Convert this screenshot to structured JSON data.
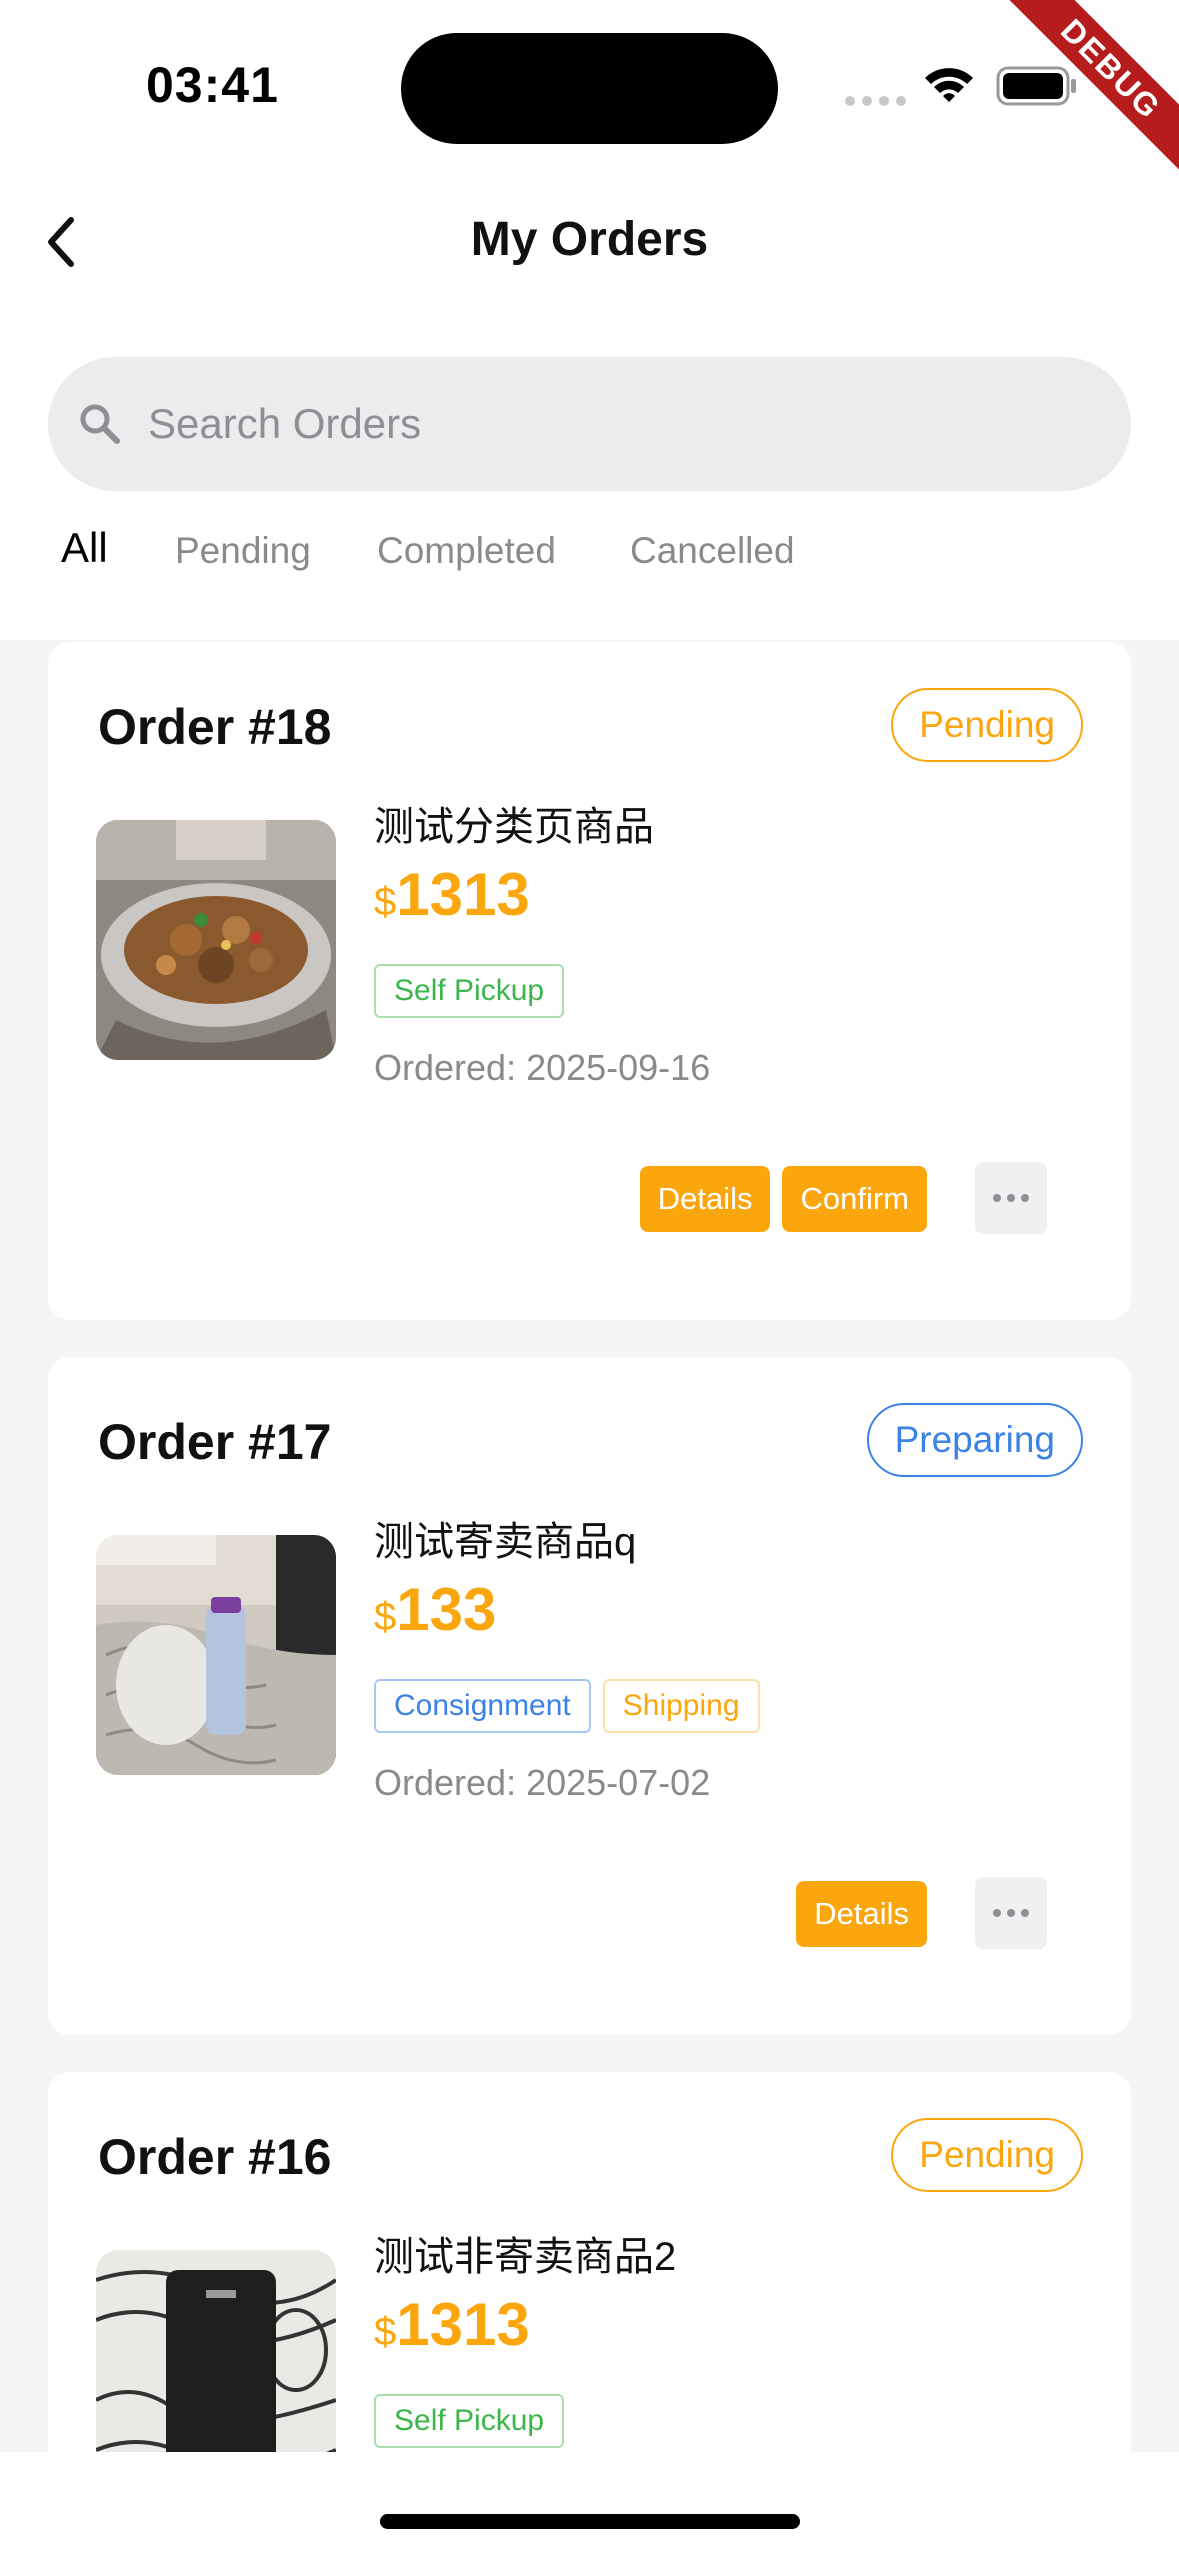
{
  "status": {
    "time": "03:41",
    "debug_label": "DEBUG"
  },
  "header": {
    "title": "My Orders"
  },
  "search": {
    "placeholder": "Search Orders"
  },
  "tabs": [
    {
      "label": "All",
      "active": true
    },
    {
      "label": "Pending",
      "active": false
    },
    {
      "label": "Completed",
      "active": false
    },
    {
      "label": "Cancelled",
      "active": false
    }
  ],
  "colors": {
    "accent": "#fba60c",
    "pending": "#fba60c",
    "preparing": "#3b82e6",
    "pickup_green": "#3cb54a",
    "background": "#f5f5f7"
  },
  "orders": [
    {
      "order_no": "Order #18",
      "status": "Pending",
      "product": "测试分类页商品",
      "currency": "$",
      "price": "1313",
      "tags": [
        "Self Pickup"
      ],
      "date": "Ordered: 2025-09-16",
      "actions": [
        "Details",
        "Confirm"
      ]
    },
    {
      "order_no": "Order #17",
      "status": "Preparing",
      "product": "测试寄卖商品q",
      "currency": "$",
      "price": "133",
      "tags": [
        "Consignment",
        "Shipping"
      ],
      "date": "Ordered: 2025-07-02",
      "actions": [
        "Details"
      ]
    },
    {
      "order_no": "Order #16",
      "status": "Pending",
      "product": "测试非寄卖商品2",
      "currency": "$",
      "price": "1313",
      "tags": [
        "Self Pickup"
      ]
    }
  ]
}
